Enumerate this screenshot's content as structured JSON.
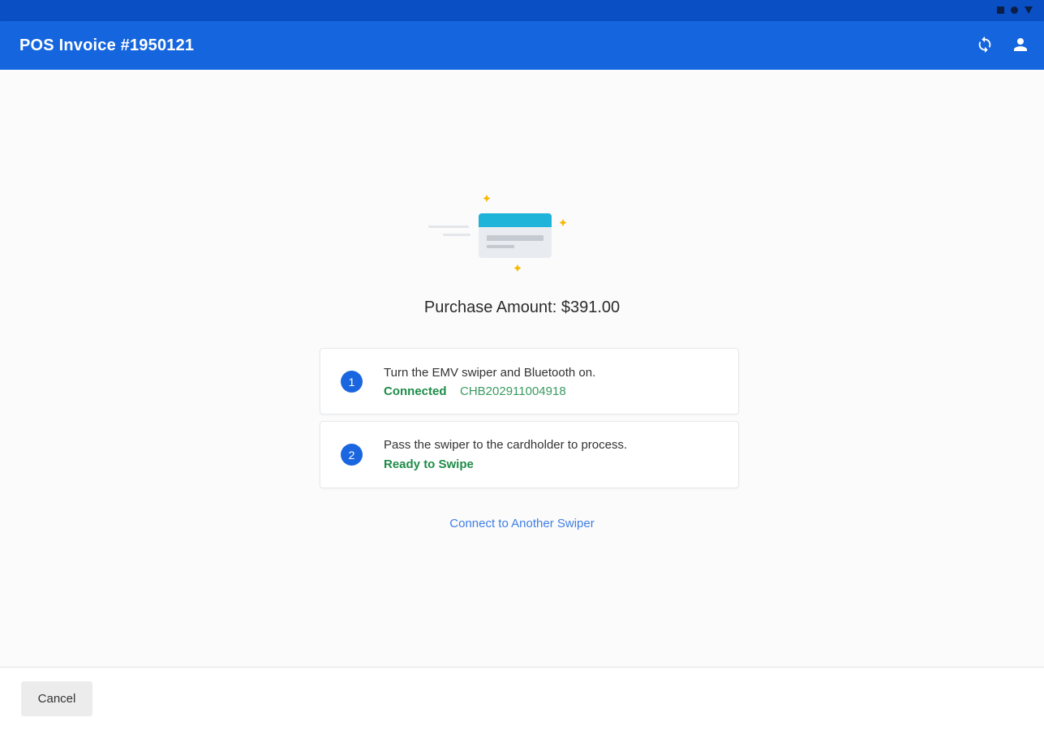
{
  "app": {
    "title": "POS Invoice #1950121",
    "actions": [
      {
        "name": "refresh",
        "icon": "sync-icon"
      },
      {
        "name": "account",
        "icon": "person-icon"
      }
    ],
    "brand_color": "#1565de",
    "status_bar_color": "#0a4fc4"
  },
  "payment": {
    "purchase_amount_line": "Purchase Amount: $391.00"
  },
  "steps": [
    {
      "number": "1",
      "instruction": "Turn the EMV swiper and Bluetooth on.",
      "status": "Connected",
      "device_id": "CHB202911004918"
    },
    {
      "number": "2",
      "instruction": "Pass the swiper to the cardholder to process.",
      "status": "Ready to Swipe"
    }
  ],
  "links": {
    "connect_another": "Connect to Another Swiper"
  },
  "footer": {
    "cancel_label": "Cancel"
  },
  "icons": {
    "illustration": "credit-card-swipe-illustration",
    "status_bar": [
      "square-icon",
      "circle-icon",
      "triangle-icon"
    ]
  },
  "colors": {
    "accent": "#1a66e0",
    "success": "#1e8c48",
    "link": "#3f7ee6",
    "card_stripe": "#1eb3d8",
    "sparkle": "#f6b800"
  }
}
